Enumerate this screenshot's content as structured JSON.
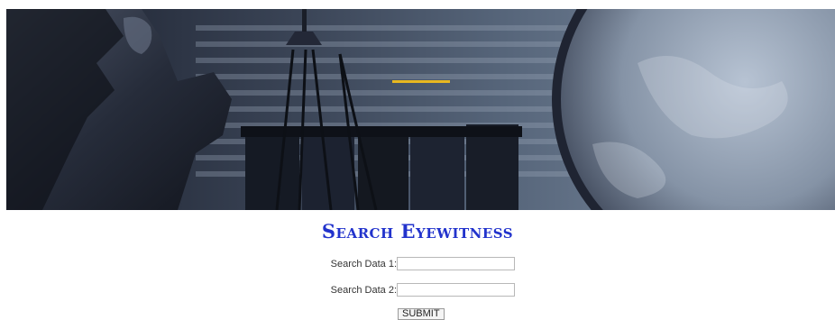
{
  "hero": {
    "image": "lady-justice-scales-books-globe",
    "accent_color": "#e8b820"
  },
  "page": {
    "title": "Search Eyewitness",
    "title_color": "#2233cc"
  },
  "form": {
    "field1": {
      "label": "Search Data 1:",
      "value": "",
      "placeholder": ""
    },
    "field2": {
      "label": "Search Data 2:",
      "value": "",
      "placeholder": ""
    },
    "submit_label": "SUBMIT"
  }
}
